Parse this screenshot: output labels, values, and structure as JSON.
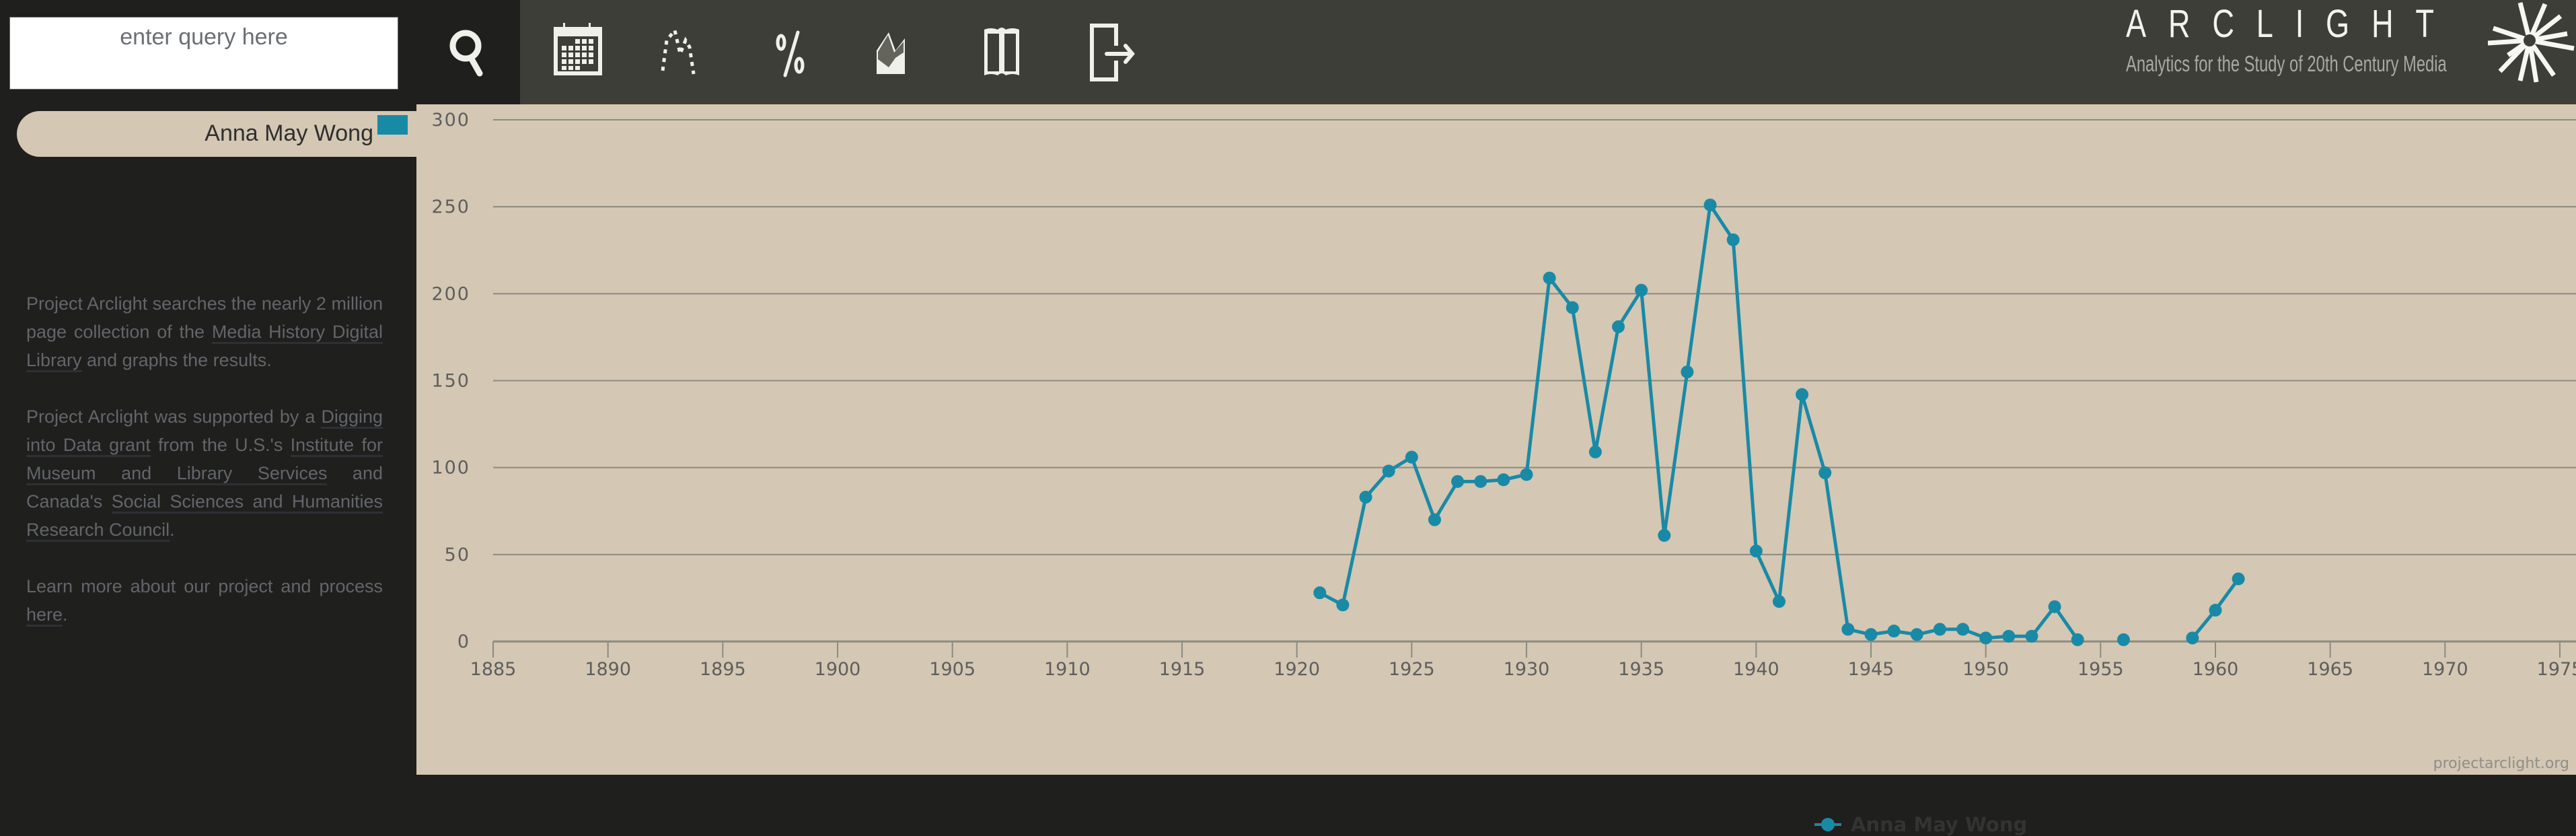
{
  "search": {
    "placeholder": "enter query here",
    "value": ""
  },
  "toolbar": {
    "items": [
      {
        "name": "search-button",
        "icon": "search-icon"
      },
      {
        "name": "calendar-button",
        "icon": "calendar-icon"
      },
      {
        "name": "trend-button",
        "icon": "dotted-trend-icon"
      },
      {
        "name": "percent-button",
        "icon": "percent-icon"
      },
      {
        "name": "area-chart-button",
        "icon": "area-chart-icon"
      },
      {
        "name": "book-button",
        "icon": "open-book-icon"
      },
      {
        "name": "export-button",
        "icon": "exit-arrow-icon"
      }
    ]
  },
  "logo": {
    "title": "ARCLIGHT",
    "subtitle": "Analytics for the Study of 20th Century Media"
  },
  "sidebar": {
    "query": {
      "label": "Anna May Wong",
      "color": "#198aa6"
    },
    "para1": {
      "t1": "Project Arclight searches the nearly 2 million page collection of the ",
      "link1": "Media History Digital Library",
      "t2": " and graphs the results."
    },
    "para2": {
      "t1": "Project Arclight was supported by a ",
      "link1": "Digging into Data grant",
      "t2": " from the U.S.'s ",
      "link2": "Institute for Museum and Library Services",
      "t3": " and Canada's ",
      "link3": "Social Sciences and Humanities Research Council",
      "t4": "."
    },
    "para3": {
      "t1": "Learn more about our project and process ",
      "link1": "here",
      "t2": "."
    }
  },
  "credit": "projectarclight.org",
  "chart_data": {
    "type": "line",
    "title": "",
    "xlabel": "",
    "ylabel": "",
    "xlim": [
      1885,
      1975
    ],
    "ylim": [
      0,
      300
    ],
    "grid": true,
    "legend": "bottom-center",
    "x_ticks": [
      1885,
      1890,
      1895,
      1900,
      1905,
      1910,
      1915,
      1920,
      1925,
      1930,
      1935,
      1940,
      1945,
      1950,
      1955,
      1960,
      1965,
      1970,
      1975
    ],
    "y_ticks": [
      0,
      50,
      100,
      150,
      200,
      250,
      300
    ],
    "series": [
      {
        "name": "Anna May Wong",
        "color": "#198aa6",
        "x": [
          1921,
          1922,
          1923,
          1924,
          1925,
          1926,
          1927,
          1928,
          1929,
          1930,
          1931,
          1932,
          1933,
          1934,
          1935,
          1936,
          1937,
          1938,
          1939,
          1940,
          1941,
          1942,
          1943,
          1944,
          1945,
          1946,
          1947,
          1948,
          1949,
          1950,
          1951,
          1952,
          1953,
          1954,
          1955,
          1956,
          1957,
          1958,
          1959,
          1960,
          1961
        ],
        "values": [
          28,
          21,
          83,
          98,
          106,
          70,
          92,
          92,
          93,
          96,
          209,
          192,
          109,
          181,
          202,
          61,
          155,
          251,
          231,
          52,
          23,
          142,
          97,
          7,
          4,
          6,
          4,
          7,
          7,
          2,
          3,
          3,
          20,
          1,
          null,
          1,
          null,
          null,
          2,
          18,
          36
        ]
      }
    ]
  }
}
